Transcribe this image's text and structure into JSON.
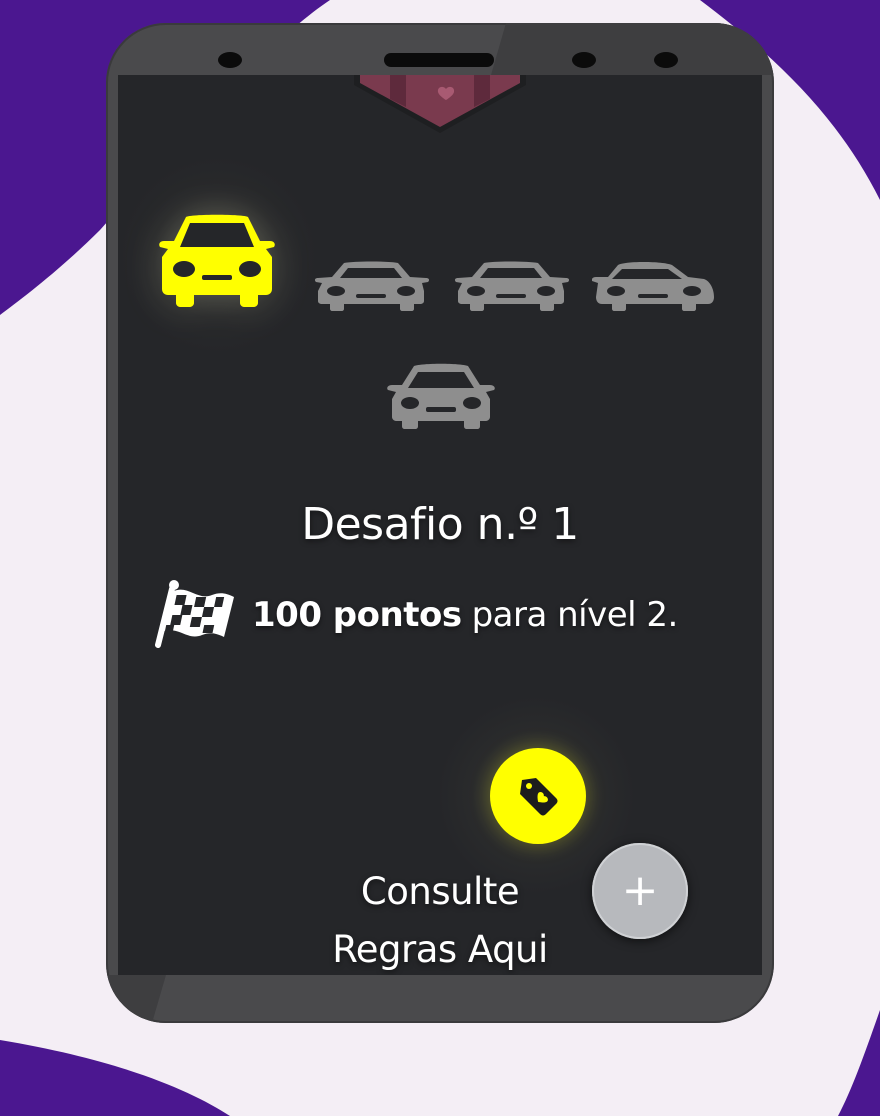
{
  "challenge": {
    "title": "Desafio n.º 1",
    "goal_bold": "100 pontos",
    "goal_rest": "para nível 2."
  },
  "cars": {
    "total": 5,
    "active_index": 0,
    "active_color": "#ffff00",
    "inactive_color": "#8e8e8e"
  },
  "actions": {
    "tag_icon": "heart-tag-icon",
    "plus_label": "+",
    "rules_line1": "Consulte",
    "rules_line2": "Regras Aqui"
  },
  "colors": {
    "background": "#f4eef5",
    "accent_purple": "#4b1790",
    "screen": "#252629",
    "frame": "#4a4a4c",
    "accent_yellow": "#ffff00"
  }
}
